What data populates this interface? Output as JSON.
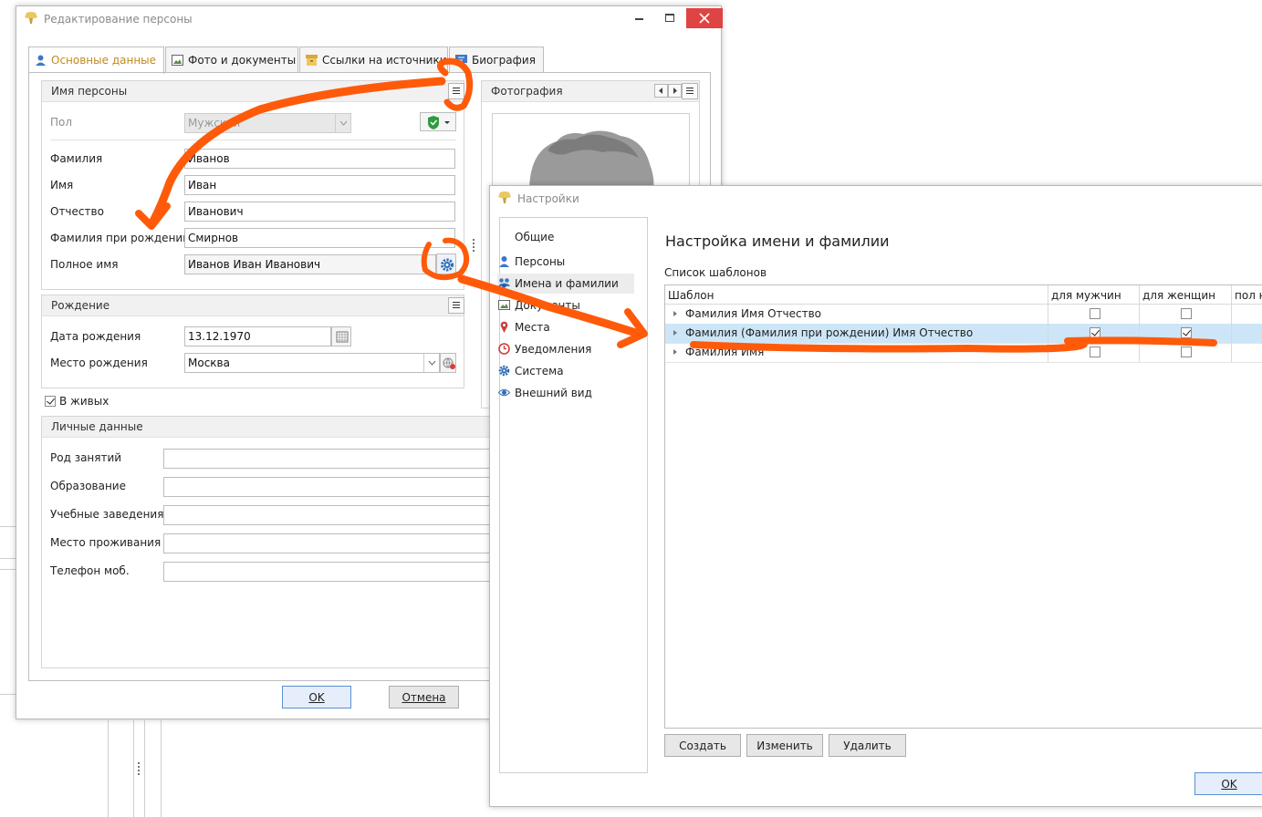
{
  "person_window": {
    "title": "Редактирование персоны",
    "tabs": [
      {
        "label": "Основные данные"
      },
      {
        "label": "Фото и документы"
      },
      {
        "label": "Ссылки на источники"
      },
      {
        "label": "Биография"
      }
    ],
    "name_section": {
      "title": "Имя персоны",
      "gender_label": "Пол",
      "gender_value": "Мужской",
      "surname_label": "Фамилия",
      "surname_value": "Иванов",
      "name_label": "Имя",
      "name_value": "Иван",
      "patronymic_label": "Отчество",
      "patronymic_value": "Иванович",
      "birth_surname_label": "Фамилия при рождении",
      "birth_surname_value": "Смирнов",
      "full_name_label": "Полное имя",
      "full_name_value": "Иванов Иван Иванович"
    },
    "birth_section": {
      "title": "Рождение",
      "date_label": "Дата рождения",
      "date_value": "13.12.1970",
      "place_label": "Место рождения",
      "place_value": "Москва"
    },
    "alive_label": "В живых",
    "alive_checked": true,
    "photo_section": {
      "title": "Фотография"
    },
    "personal_section": {
      "title": "Личные данные",
      "fields": [
        {
          "label": "Род занятий",
          "value": ""
        },
        {
          "label": "Образование",
          "value": ""
        },
        {
          "label": "Учебные заведения",
          "value": ""
        },
        {
          "label": "Место проживания",
          "value": ""
        },
        {
          "label": "Телефон моб.",
          "value": ""
        }
      ]
    },
    "ok_label": "OK",
    "cancel_label": "Отмена"
  },
  "settings_window": {
    "title": "Настройки",
    "nav": [
      {
        "label": "Общие",
        "icon": "none"
      },
      {
        "label": "Персоны",
        "icon": "person-icon"
      },
      {
        "label": "Имена и фамилии",
        "icon": "names-icon",
        "selected": true
      },
      {
        "label": "Документы",
        "icon": "documents-icon"
      },
      {
        "label": "Места",
        "icon": "map-pin-icon"
      },
      {
        "label": "Уведомления",
        "icon": "clock-icon"
      },
      {
        "label": "Система",
        "icon": "gear-icon"
      },
      {
        "label": "Внешний вид",
        "icon": "eye-icon"
      }
    ],
    "heading": "Настройка имени и фамилии",
    "list_label": "Список шаблонов",
    "columns": [
      "Шаблон",
      "для мужчин",
      "для женщин",
      "пол н"
    ],
    "rows": [
      {
        "template": "Фамилия Имя Отчество",
        "male": false,
        "female": false
      },
      {
        "template": "Фамилия (Фамилия при рождении) Имя Отчество",
        "male": true,
        "female": true
      },
      {
        "template": "Фамилия Имя",
        "male": false,
        "female": false
      }
    ],
    "create_label": "Создать",
    "edit_label": "Изменить",
    "delete_label": "Удалить",
    "ok_label": "OK"
  },
  "colors": {
    "annotation": "#ff5a0a",
    "active_tab_text": "#c48a1a",
    "selection": "#cde6f7"
  }
}
